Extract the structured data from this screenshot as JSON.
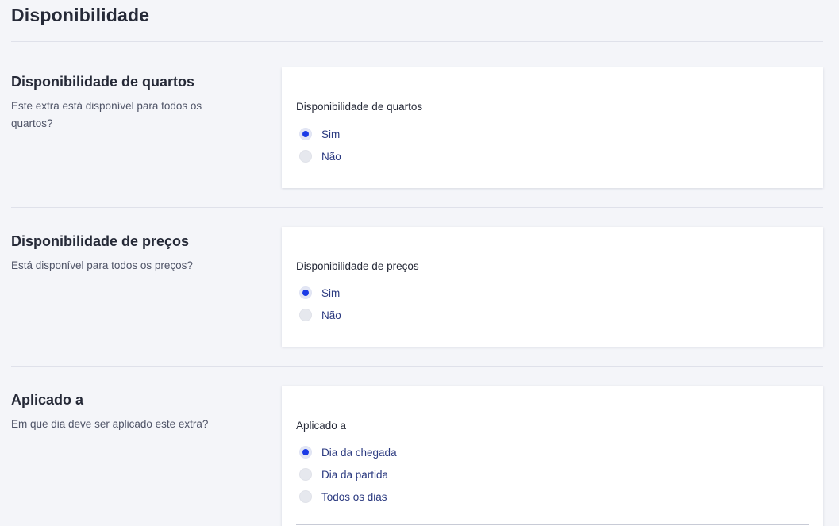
{
  "page": {
    "title": "Disponibilidade"
  },
  "sections": [
    {
      "title": "Disponibilidade de quartos",
      "description": "Este extra está disponível para todos os quartos?",
      "card_label": "Disponibilidade de quartos",
      "options": [
        {
          "label": "Sim",
          "checked": true
        },
        {
          "label": "Não",
          "checked": false
        }
      ]
    },
    {
      "title": "Disponibilidade de preços",
      "description": "Está disponível para todos os preços?",
      "card_label": "Disponibilidade de preços",
      "options": [
        {
          "label": "Sim",
          "checked": true
        },
        {
          "label": "Não",
          "checked": false
        }
      ]
    },
    {
      "title": "Aplicado a",
      "description": "Em que dia deve ser aplicado este extra?",
      "card_label": "Aplicado a",
      "options": [
        {
          "label": "Dia da chegada",
          "checked": true
        },
        {
          "label": "Dia da partida",
          "checked": false
        },
        {
          "label": "Todos os dias",
          "checked": false
        }
      ]
    }
  ],
  "colors": {
    "background": "#f4f5f9",
    "card": "#ffffff",
    "accent": "#1a3ae6",
    "option_text": "#2b3a80"
  }
}
